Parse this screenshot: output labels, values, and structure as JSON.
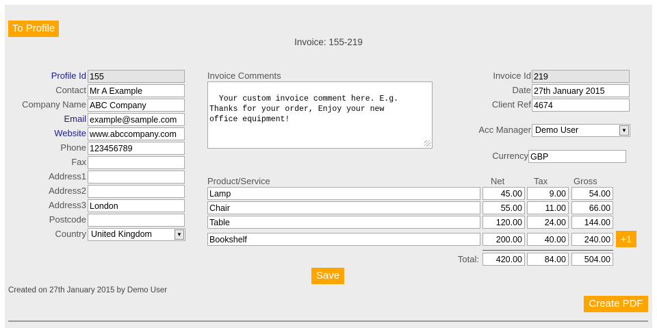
{
  "buttons": {
    "to_profile": "To Profile",
    "save": "Save",
    "create_pdf": "Create PDF",
    "add_row": "+1"
  },
  "invoice_heading": "Invoice: 155-219",
  "profile": {
    "labels": {
      "profile_id": "Profile Id",
      "contact": "Contact",
      "company_name": "Company Name",
      "email": "Email",
      "website": "Website",
      "phone": "Phone",
      "fax": "Fax",
      "address1": "Address1",
      "address2": "Address2",
      "address3": "Address3",
      "postcode": "Postcode",
      "country": "Country"
    },
    "values": {
      "profile_id": "155",
      "contact": "Mr A Example",
      "company_name": "ABC Company",
      "email": "example@sample.com",
      "website": "www.abccompany.com",
      "phone": "123456789",
      "fax": "",
      "address1": "",
      "address2": "",
      "address3": "London",
      "postcode": "",
      "country": "United Kingdom"
    }
  },
  "comments": {
    "label": "Invoice Comments",
    "text": "Your custom invoice comment here. E.g.\nThanks for your order, Enjoy your new\noffice equipment!"
  },
  "invoice": {
    "labels": {
      "invoice_id": "Invoice Id",
      "date": "Date",
      "client_ref": "Client Ref",
      "acc_manager": "Acc Manager",
      "currency": "Currency"
    },
    "values": {
      "invoice_id": "219",
      "date": "27th January 2015",
      "client_ref": "4674",
      "acc_manager": "Demo User",
      "currency": "GBP"
    }
  },
  "items": {
    "headers": {
      "product": "Product/Service",
      "net": "Net",
      "tax": "Tax",
      "gross": "Gross"
    },
    "rows": [
      {
        "product": "Lamp",
        "net": "45.00",
        "tax": "9.00",
        "gross": "54.00"
      },
      {
        "product": "Chair",
        "net": "55.00",
        "tax": "11.00",
        "gross": "66.00"
      },
      {
        "product": "Table",
        "net": "120.00",
        "tax": "24.00",
        "gross": "144.00"
      },
      {
        "product": "Bookshelf",
        "net": "200.00",
        "tax": "40.00",
        "gross": "240.00"
      }
    ],
    "total_label": "Total:",
    "totals": {
      "net": "420.00",
      "tax": "84.00",
      "gross": "504.00"
    }
  },
  "footer": {
    "created": "Created on 27th January 2015 by Demo User"
  },
  "colors": {
    "accent": "#ffa500",
    "panel": "#ececec",
    "label_blue": "#1c1c8c",
    "readonly": "#e4e4e4"
  }
}
